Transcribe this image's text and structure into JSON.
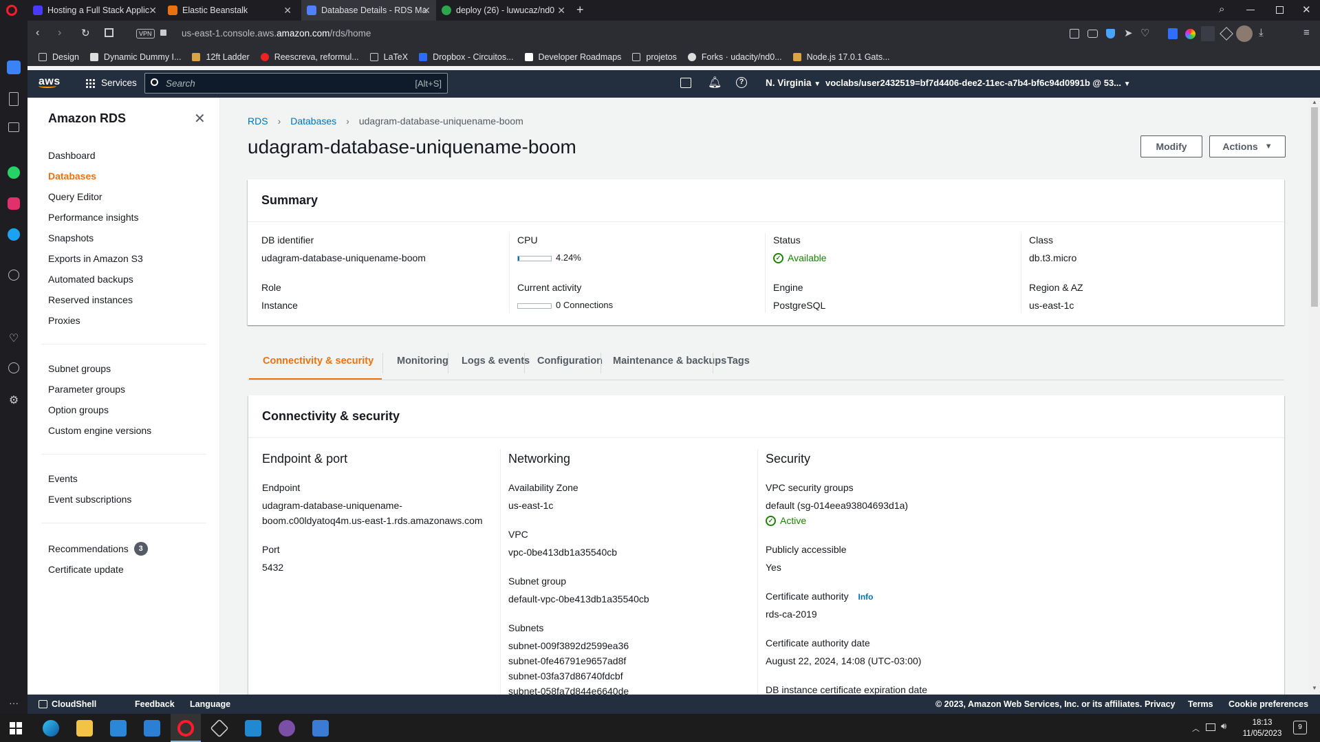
{
  "browser": {
    "tabs": [
      {
        "title": "Hosting a Full Stack Applic",
        "active": false,
        "color": "#4a3aff"
      },
      {
        "title": "Elastic Beanstalk",
        "active": false,
        "color": "#ec7211"
      },
      {
        "title": "Database Details - RDS Ma",
        "active": true,
        "color": "#527fff"
      },
      {
        "title": "deploy (26) - luwucaz/nd0",
        "active": false,
        "color": "#2da44e"
      }
    ],
    "url_prefix": "us-east-1.console.aws.",
    "url_domain": "amazon.com",
    "url_path": "/rds/home",
    "vpn_label": "VPN",
    "bookmarks": [
      {
        "label": "Design",
        "icon": "folder"
      },
      {
        "label": "Dynamic Dummy I...",
        "icon": "page"
      },
      {
        "label": "12ft Ladder",
        "icon": "ladder"
      },
      {
        "label": "Reescreva, reformul...",
        "icon": "red-circle"
      },
      {
        "label": "LaTeX",
        "icon": "folder"
      },
      {
        "label": "Dropbox - Circuitos...",
        "icon": "dropbox"
      },
      {
        "label": "Developer Roadmaps",
        "icon": "roadmap"
      },
      {
        "label": "projetos",
        "icon": "folder"
      },
      {
        "label": "Forks · udacity/nd0...",
        "icon": "github"
      },
      {
        "label": "Node.js 17.0.1 Gats...",
        "icon": "gatsby"
      }
    ]
  },
  "aws_header": {
    "logo": "aws",
    "services_label": "Services",
    "search_placeholder": "Search",
    "search_shortcut": "[Alt+S]",
    "region": "N. Virginia",
    "account": "voclabs/user2432519=bf7d4406-dee2-11ec-a7b4-bf6c94d0991b @ 53..."
  },
  "nav": {
    "title": "Amazon RDS",
    "group1": [
      "Dashboard",
      "Databases",
      "Query Editor",
      "Performance insights",
      "Snapshots",
      "Exports in Amazon S3",
      "Automated backups",
      "Reserved instances",
      "Proxies"
    ],
    "active": "Databases",
    "group2": [
      "Subnet groups",
      "Parameter groups",
      "Option groups",
      "Custom engine versions"
    ],
    "group3": [
      "Events",
      "Event subscriptions"
    ],
    "recommendations_label": "Recommendations",
    "recommendations_count": "3",
    "certificate_update": "Certificate update"
  },
  "breadcrumb": [
    "RDS",
    "Databases",
    "udagram-database-uniquename-boom"
  ],
  "page_title": "udagram-database-uniquename-boom",
  "buttons": {
    "modify": "Modify",
    "actions": "Actions"
  },
  "summary": {
    "heading": "Summary",
    "db_identifier_label": "DB identifier",
    "db_identifier": "udagram-database-uniquename-boom",
    "role_label": "Role",
    "role": "Instance",
    "cpu_label": "CPU",
    "cpu": "4.24%",
    "cpu_fraction": 0.0424,
    "activity_label": "Current activity",
    "activity": "0 Connections",
    "status_label": "Status",
    "status": "Available",
    "engine_label": "Engine",
    "engine": "PostgreSQL",
    "class_label": "Class",
    "class": "db.t3.micro",
    "region_label": "Region & AZ",
    "region": "us-east-1c"
  },
  "tabs": [
    "Connectivity & security",
    "Monitoring",
    "Logs & events",
    "Configuration",
    "Maintenance & backups",
    "Tags"
  ],
  "active_tab": "Connectivity & security",
  "connectivity": {
    "heading": "Connectivity & security",
    "endpoint_port_heading": "Endpoint & port",
    "endpoint_label": "Endpoint",
    "endpoint_line1": "udagram-database-uniquename-",
    "endpoint_line2": "boom.c00ldyatoq4m.us-east-1.rds.amazonaws.com",
    "port_label": "Port",
    "port": "5432",
    "networking_heading": "Networking",
    "az_label": "Availability Zone",
    "az": "us-east-1c",
    "vpc_label": "VPC",
    "vpc": "vpc-0be413db1a35540cb",
    "subnet_group_label": "Subnet group",
    "subnet_group": "default-vpc-0be413db1a35540cb",
    "subnets_label": "Subnets",
    "subnets": [
      "subnet-009f3892d2599ea36",
      "subnet-0fe46791e9657ad8f",
      "subnet-03fa37d86740fdcbf",
      "subnet-058fa7d844e6640de"
    ],
    "security_heading": "Security",
    "vpc_sg_label": "VPC security groups",
    "vpc_sg": "default (sg-014eea93804693d1a)",
    "vpc_sg_status": "Active",
    "public_label": "Publicly accessible",
    "public": "Yes",
    "ca_label": "Certificate authority",
    "ca_info": "Info",
    "ca": "rds-ca-2019",
    "ca_date_label": "Certificate authority date",
    "ca_date": "August 22, 2024, 14:08 (UTC-03:00)",
    "cert_exp_label": "DB instance certificate expiration date"
  },
  "footer": {
    "cloudshell": "CloudShell",
    "feedback": "Feedback",
    "language": "Language",
    "copyright": "© 2023, Amazon Web Services, Inc. or its affiliates.",
    "privacy": "Privacy",
    "terms": "Terms",
    "cookies": "Cookie preferences"
  },
  "taskbar": {
    "time": "18:13",
    "date": "11/05/2023",
    "notifications": "9"
  },
  "colors": {
    "aws_dark": "#232f3e",
    "link": "#0073bb",
    "orange": "#ec7211",
    "success": "#1d8102"
  }
}
